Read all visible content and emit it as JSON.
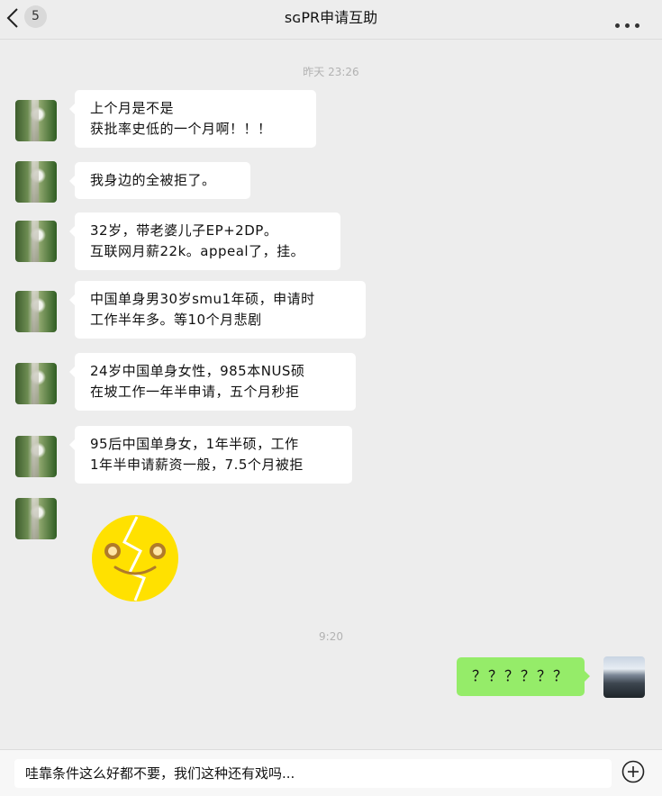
{
  "header": {
    "unread_count": "5",
    "title": "sɢPR申请互助",
    "back_icon": "chevron-left-icon",
    "more_icon": "more-dots-icon"
  },
  "timestamps": [
    "昨天 23:26",
    "9:20"
  ],
  "messages": [
    {
      "sender": "other",
      "lines": [
        "上个月是不是",
        "获批率史低的一个月啊！！！"
      ]
    },
    {
      "sender": "other",
      "lines": [
        "我身边的全被拒了。"
      ]
    },
    {
      "sender": "other",
      "lines": [
        "32岁，带老婆儿子EP+2DP。",
        "互联网月薪22k。appeal了，挂。"
      ]
    },
    {
      "sender": "other",
      "lines": [
        "中国单身男30岁smu1年硕，申请时",
        "工作半年多。等10个月悲剧"
      ]
    },
    {
      "sender": "other",
      "lines": [
        "24岁中国单身女性，985本NUS硕",
        "在坡工作一年半申请，五个月秒拒"
      ]
    },
    {
      "sender": "other",
      "lines": [
        "95后中国单身女，1年半硕，工作",
        "1年半申请薪资一般，7.5个月被拒"
      ]
    },
    {
      "sender": "other",
      "sticker": "broken-face-emoji"
    },
    {
      "sender": "me",
      "lines": [
        "？？？？？？"
      ]
    }
  ],
  "input": {
    "value": "哇靠条件这么好都不要，我们这种还有戏吗...",
    "plus_icon": "plus-circle-icon"
  },
  "colors": {
    "background": "#ededed",
    "my_bubble": "#95ec69",
    "other_bubble": "#ffffff",
    "timestamp": "#b2b2b2",
    "emoji_face": "#ffe100"
  }
}
